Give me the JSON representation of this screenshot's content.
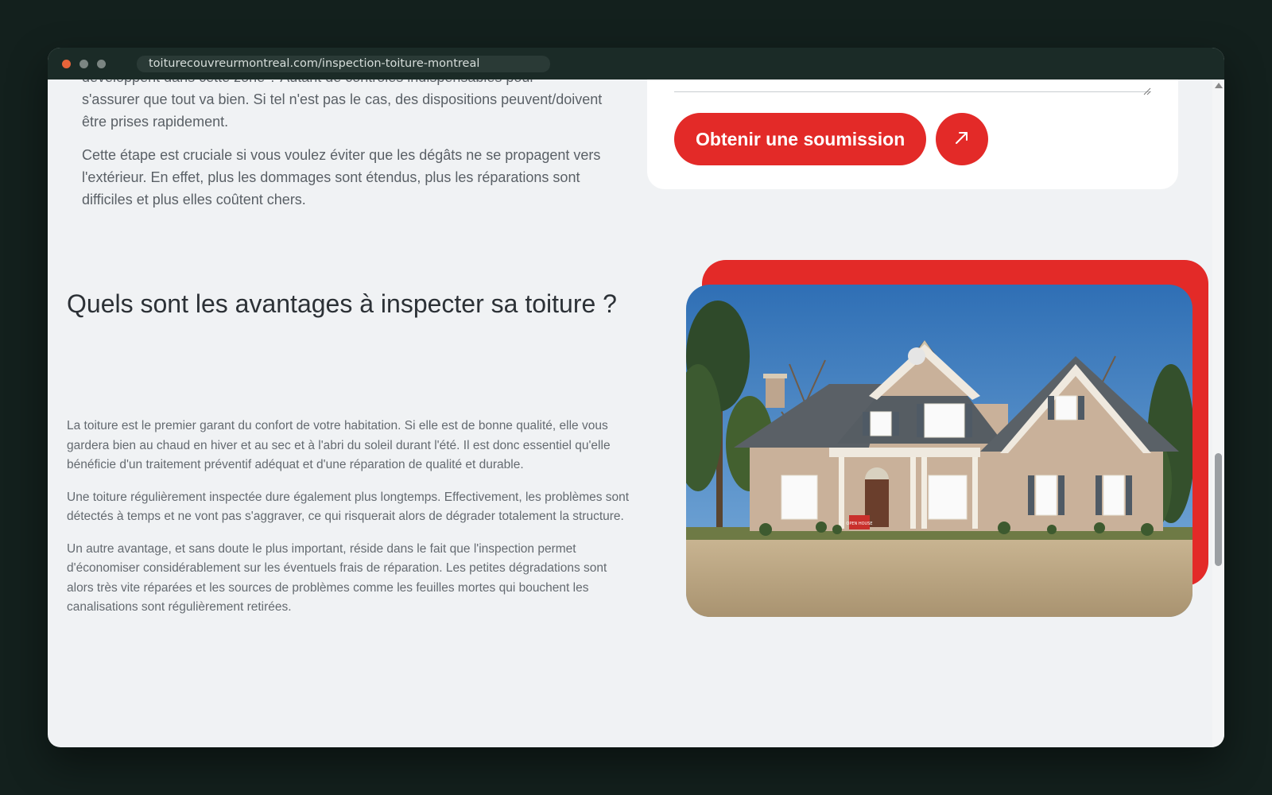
{
  "browser": {
    "url": "toiturecouvreurmontreal.com/inspection-toiture-montreal"
  },
  "intro": {
    "partial_line": "développent dans cette zone ? Autant de contrôles indispensables pour",
    "p1_rest": "s'assurer que tout va bien. Si tel n'est pas le cas, des dispositions peuvent/doivent être prises rapidement.",
    "p2": "Cette étape est cruciale si vous voulez éviter que les dégâts ne se propagent vers l'extérieur. En effet, plus les dommages sont étendus, plus les réparations sont difficiles et plus elles coûtent chers."
  },
  "form": {
    "submit_label": "Obtenir une soumission",
    "arrow_icon": "arrow-up-right-icon"
  },
  "section": {
    "title": "Quels sont les avantages à inspecter sa toiture ?",
    "paragraphs": [
      "La toiture est le premier garant du confort de votre habitation. Si elle est de bonne qualité, elle vous gardera bien au chaud en hiver et au sec et à l'abri du soleil durant l'été. Il est donc essentiel qu'elle bénéficie d'un traitement préventif adéquat et d'une réparation de qualité et durable.",
      "Une toiture régulièrement inspectée dure également plus longtemps. Effectivement, les problèmes sont détectés à temps et ne vont pas s'aggraver, ce qui risquerait alors de dégrader totalement la structure.",
      "Un autre avantage, et sans doute le plus important, réside dans le fait que l'inspection permet d'économiser considérablement sur les éventuels frais de réparation. Les petites dégradations sont alors très vite réparées et les sources de problèmes comme les feuilles mortes qui bouchent les canalisations sont régulièrement retirées."
    ],
    "sign_text": "OPEN HOUSE"
  },
  "colors": {
    "accent": "#e32a28",
    "background": "#f0f2f4",
    "heading": "#2c3136",
    "body": "#646a70"
  }
}
